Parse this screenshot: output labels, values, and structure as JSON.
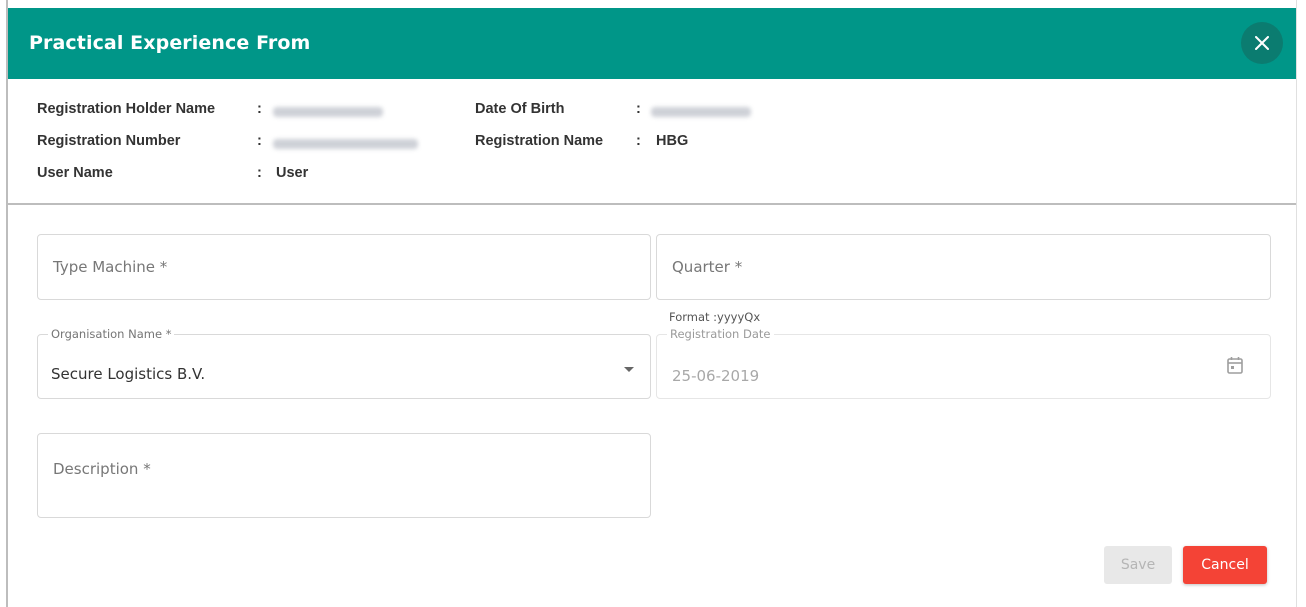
{
  "dialog": {
    "title": "Practical Experience From",
    "close_icon": "close-icon"
  },
  "info": {
    "registration_holder_name": {
      "label": "Registration Holder Name",
      "colon": ":"
    },
    "registration_number": {
      "label": "Registration Number",
      "colon": ":"
    },
    "user_name": {
      "label": "User Name",
      "colon": ":",
      "value": "User"
    },
    "date_of_birth": {
      "label": "Date Of Birth",
      "colon": ":"
    },
    "registration_name": {
      "label": "Registration Name",
      "colon": ":",
      "value": "HBG"
    }
  },
  "form": {
    "type_machine": {
      "placeholder": "Type Machine *",
      "value": ""
    },
    "quarter": {
      "placeholder": "Quarter *",
      "value": "",
      "hint": "Format :yyyyQx"
    },
    "organisation_name": {
      "label": "Organisation Name *",
      "value": "Secure Logistics B.V.",
      "icon": "chevron-down-icon"
    },
    "registration_date": {
      "label": "Registration Date",
      "value": "25-06-2019",
      "icon": "calendar-icon"
    },
    "description": {
      "placeholder": "Description *",
      "value": ""
    }
  },
  "actions": {
    "save_label": "Save",
    "cancel_label": "Cancel"
  },
  "colors": {
    "header": "#009688",
    "close_button": "#0b7c70",
    "cancel": "#f44336",
    "save_disabled": "#e8e8e8"
  }
}
